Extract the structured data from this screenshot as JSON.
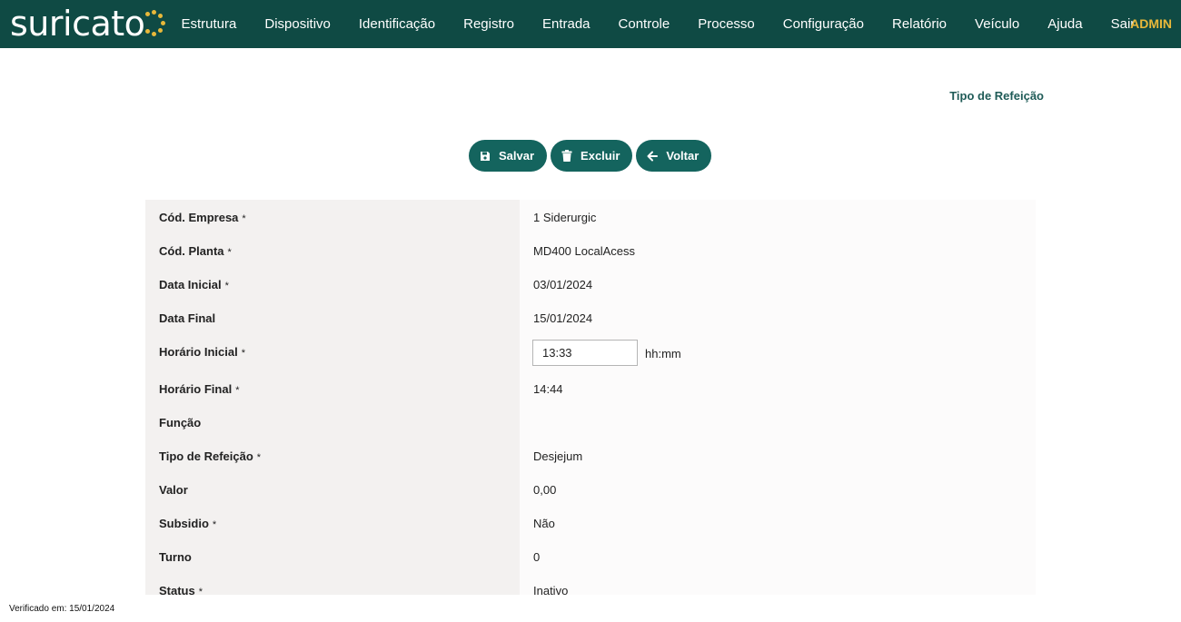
{
  "brand": {
    "name": "suricato"
  },
  "nav": {
    "items": [
      "Estrutura",
      "Dispositivo",
      "Identificação",
      "Registro",
      "Entrada",
      "Controle",
      "Processo",
      "Configuração",
      "Relatório",
      "Veículo",
      "Ajuda",
      "Sair"
    ],
    "user": "ADMIN"
  },
  "page": {
    "title": "Tipo de Refeição"
  },
  "toolbar": {
    "save_label": "Salvar",
    "delete_label": "Excluir",
    "back_label": "Voltar"
  },
  "form": {
    "required_mark": "*",
    "fields": [
      {
        "label": "Cód. Empresa",
        "required": true,
        "value": "1 Siderurgic"
      },
      {
        "label": "Cód. Planta",
        "required": true,
        "value": "MD400 LocalAcess"
      },
      {
        "label": "Data Inicial",
        "required": true,
        "value": "03/01/2024"
      },
      {
        "label": "Data Final",
        "required": false,
        "value": "15/01/2024"
      },
      {
        "label": "Horário Inicial",
        "required": true,
        "value": "13:33",
        "hint": "hh:mm"
      },
      {
        "label": "Horário Final",
        "required": true,
        "value": "14:44"
      },
      {
        "label": "Função",
        "required": false,
        "value": ""
      },
      {
        "label": "Tipo de Refeição",
        "required": true,
        "value": "Desjejum"
      },
      {
        "label": "Valor",
        "required": false,
        "value": "0,00"
      },
      {
        "label": "Subsidio",
        "required": true,
        "value": "Não"
      },
      {
        "label": "Turno",
        "required": false,
        "value": "0"
      },
      {
        "label": "Status",
        "required": true,
        "value": "Inativo"
      }
    ]
  },
  "footer": {
    "verified": "Verificado em: 15/01/2024"
  },
  "colors": {
    "header_bg": "#0f4a44",
    "accent": "#e8b83a",
    "button_bg": "#14645e",
    "title": "#1f5b57"
  }
}
